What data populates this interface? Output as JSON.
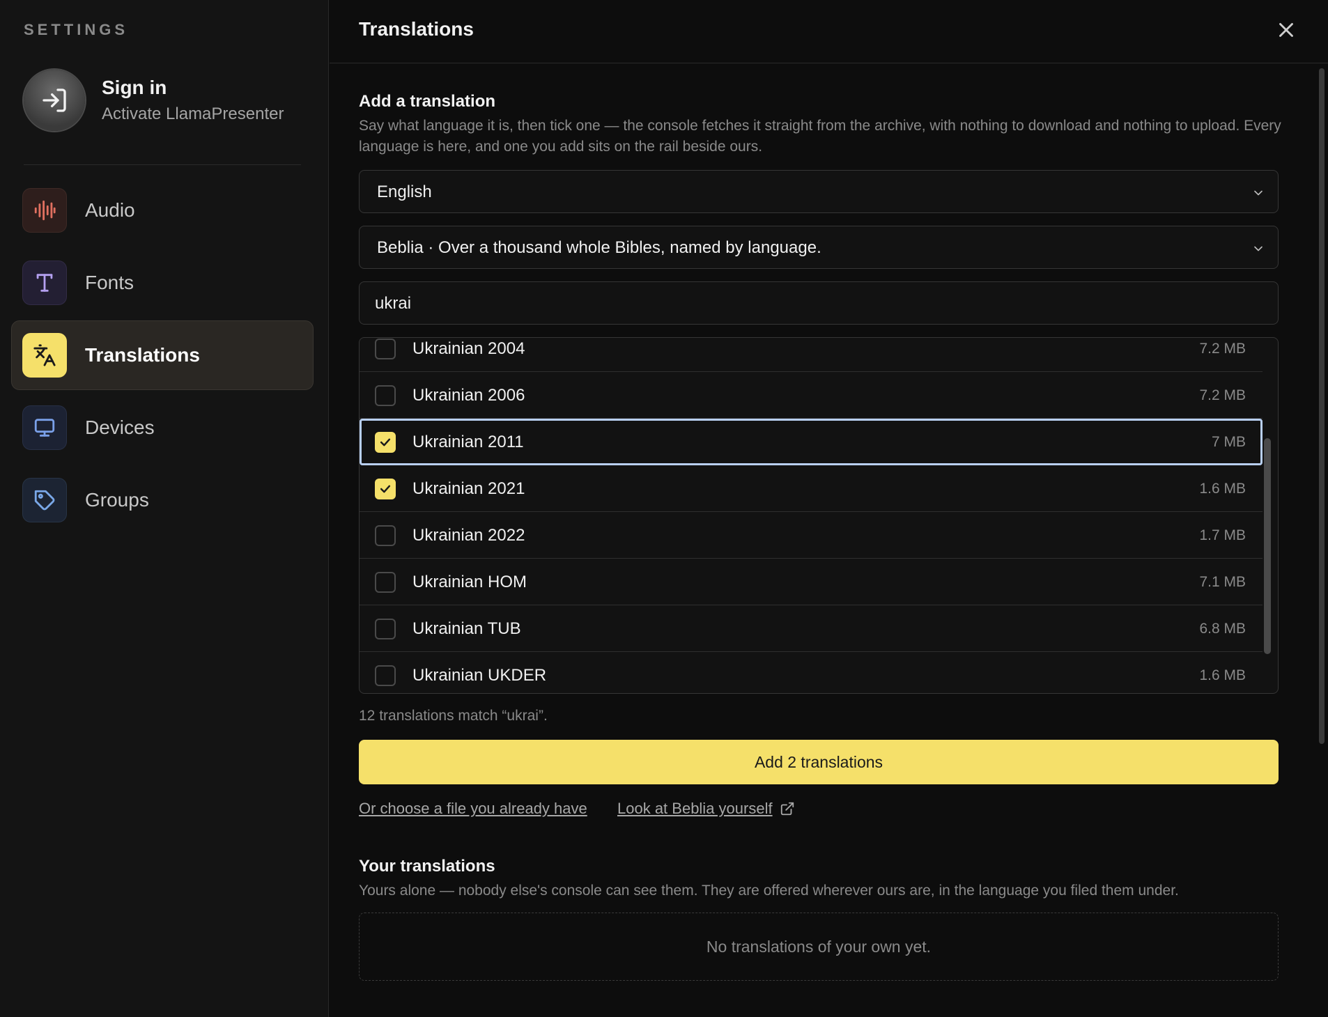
{
  "sidebar": {
    "heading": "SETTINGS",
    "signin": {
      "title": "Sign in",
      "subtitle": "Activate LlamaPresenter",
      "icon": "sign-in-icon"
    },
    "items": [
      {
        "label": "Audio",
        "icon": "audio-waveform-icon",
        "active": false,
        "color": "#e07060"
      },
      {
        "label": "Fonts",
        "icon": "type-icon",
        "active": false,
        "color": "#b4a0f0"
      },
      {
        "label": "Translations",
        "icon": "languages-icon",
        "active": true,
        "color": "#f5e06a"
      },
      {
        "label": "Devices",
        "icon": "monitor-icon",
        "active": false,
        "color": "#7aa0e8"
      },
      {
        "label": "Groups",
        "icon": "tag-icon",
        "active": false,
        "color": "#7aa8e8"
      }
    ]
  },
  "header": {
    "title": "Translations",
    "close_icon": "close-icon"
  },
  "add_section": {
    "title": "Add a translation",
    "description": "Say what language it is, then tick one — the console fetches it straight from the archive, with nothing to download and nothing to upload. Every language is here, and one you add sits on the rail beside ours.",
    "language_select": "English",
    "source_select": "Beblia · Over a thousand whole Bibles, named by language.",
    "search": {
      "value": "ukrai",
      "placeholder": ""
    },
    "results": [
      {
        "name": "Ukrainian 2004",
        "size": "7.2 MB",
        "checked": false
      },
      {
        "name": "Ukrainian 2006",
        "size": "7.2 MB",
        "checked": false
      },
      {
        "name": "Ukrainian 2011",
        "size": "7 MB",
        "checked": true,
        "focused": true
      },
      {
        "name": "Ukrainian 2021",
        "size": "1.6 MB",
        "checked": true
      },
      {
        "name": "Ukrainian 2022",
        "size": "1.7 MB",
        "checked": false
      },
      {
        "name": "Ukrainian HOM",
        "size": "7.1 MB",
        "checked": false
      },
      {
        "name": "Ukrainian TUB",
        "size": "6.8 MB",
        "checked": false
      },
      {
        "name": "Ukrainian UKDER",
        "size": "1.6 MB",
        "checked": false
      }
    ],
    "match_count": "12 translations match “ukrai”.",
    "add_button": "Add 2 translations",
    "link_file": "Or choose a file you already have",
    "link_beblia": "Look at Beblia yourself"
  },
  "your_section": {
    "title": "Your translations",
    "description": "Yours alone — nobody else's console can see them. They are offered wherever ours are, in the language you filed them under.",
    "empty": "No translations of your own yet."
  }
}
